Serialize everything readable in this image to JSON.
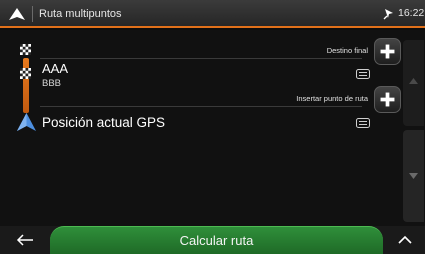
{
  "header": {
    "title": "Ruta multipuntos",
    "time": "16:22"
  },
  "route": {
    "destino_label": "Destino final",
    "insertar_label": "Insertar punto de ruta",
    "waypoint": {
      "name": "AAA",
      "sub": "BBB"
    },
    "origin": "Posición actual GPS"
  },
  "footer": {
    "calc_label": "Calcular ruta"
  },
  "icons": {
    "logo": "nav-logo-icon",
    "gps": "gps-signal-icon",
    "flag": "checkered-flag-icon",
    "arrow": "navigation-arrow-icon",
    "plus": "plus-icon",
    "menu": "menu-icon",
    "back": "back-arrow-icon",
    "up": "chevron-up-icon"
  },
  "colors": {
    "accent": "#e0701a",
    "calc_button": "#2f8f3a"
  }
}
